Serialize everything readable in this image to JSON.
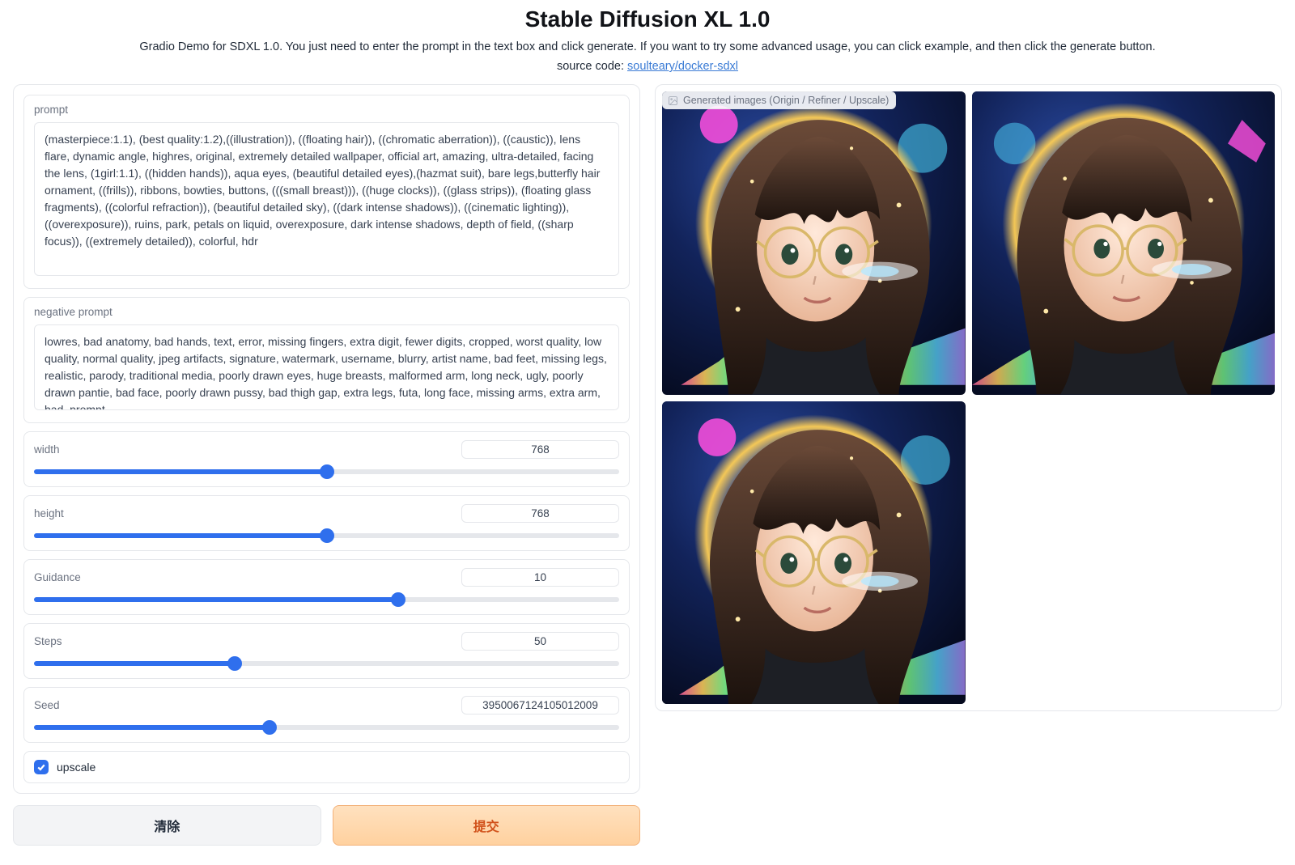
{
  "header": {
    "title": "Stable Diffusion XL 1.0",
    "subtitle": "Gradio Demo for SDXL 1.0. You just need to enter the prompt in the text box and click generate. If you want to try some advanced usage, you can click example, and then click the generate button.",
    "source_prefix": "source code: ",
    "source_link_text": "soulteary/docker-sdxl"
  },
  "form": {
    "prompt_label": "prompt",
    "prompt_value": "(masterpiece:1.1), (best quality:1.2),((illustration)), ((floating hair)), ((chromatic aberration)), ((caustic)), lens flare, dynamic angle, highres, original, extremely detailed wallpaper, official art, amazing, ultra-detailed, facing the lens, (1girl:1.1), ((hidden hands)), aqua eyes, (beautiful detailed eyes),(hazmat suit), bare legs,butterfly hair ornament, ((frills)), ribbons, bowties, buttons, (((small breast))), ((huge clocks)), ((glass strips)), (floating glass fragments), ((colorful refraction)), (beautiful detailed sky), ((dark intense shadows)), ((cinematic lighting)), ((overexposure)), ruins, park, petals on liquid, overexposure, dark intense shadows, depth of field, ((sharp focus)), ((extremely detailed)), colorful, hdr",
    "negative_label": "negative prompt",
    "negative_value": "lowres, bad anatomy, bad hands, text, error, missing fingers, extra digit, fewer digits, cropped, worst quality, low quality, normal quality, jpeg artifacts, signature, watermark, username, blurry, artist name, bad feet, missing legs, realistic, parody, traditional media, poorly drawn eyes, huge breasts, malformed arm, long neck, ugly, poorly drawn pantie, bad face, poorly drawn pussy, bad thigh gap, extra legs, futa, long face, missing arms, extra arm, bad_prompt",
    "width_label": "width",
    "width_value": "768",
    "height_label": "height",
    "height_value": "768",
    "guidance_label": "Guidance",
    "guidance_value": "10",
    "steps_label": "Steps",
    "steps_value": "50",
    "seed_label": "Seed",
    "seed_value": "3950067124105012009",
    "upscale_label": "upscale",
    "upscale_checked": true
  },
  "buttons": {
    "clear": "清除",
    "submit": "提交"
  },
  "gallery": {
    "label": "Generated images (Origin / Refiner / Upscale)"
  },
  "sliders": {
    "width": {
      "min": 0,
      "max": 1536,
      "pct": 50
    },
    "height": {
      "min": 0,
      "max": 1536,
      "pct": 50
    },
    "guidance": {
      "min": 0,
      "max": 16,
      "pct": 63
    },
    "steps": {
      "min": 0,
      "max": 150,
      "pct": 34
    },
    "seed": {
      "min": 0,
      "max": 100,
      "pct": 40
    }
  }
}
